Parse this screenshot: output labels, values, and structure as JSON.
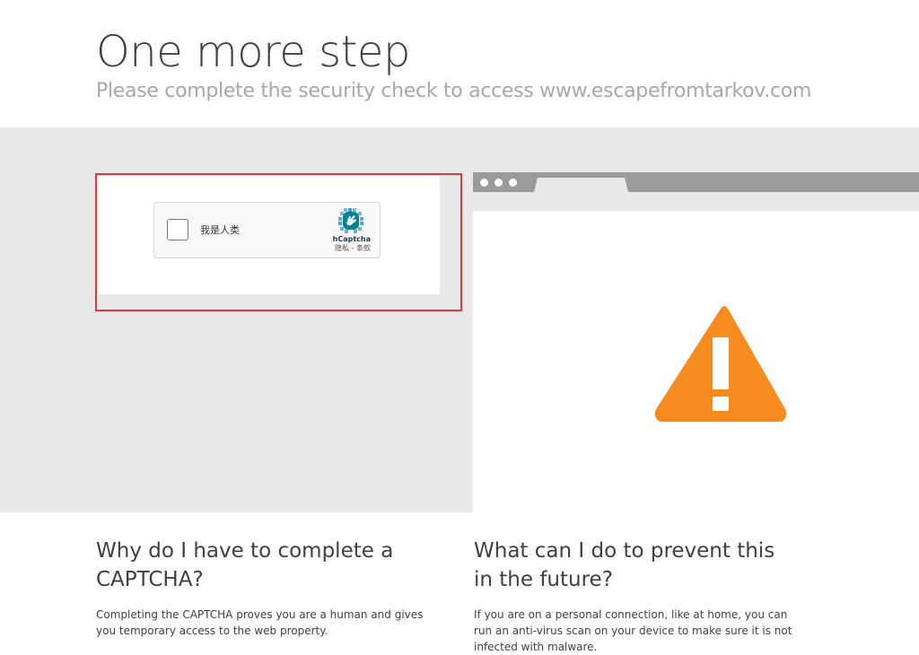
{
  "header": {
    "title": "One more step",
    "subtitle": "Please complete the security check to access www.escapefromtarkov.com"
  },
  "captcha": {
    "checkbox_label": "我是人类",
    "brand": "hCaptcha",
    "links": "隐私 - 条款",
    "highlight_color": "#e0383e"
  },
  "browser": {
    "warning_color": "#f68b1f",
    "warning_icon": "warning-triangle-exclamation"
  },
  "sections": [
    {
      "heading": "Why do I have to complete a CAPTCHA?",
      "text": "Completing the CAPTCHA proves you are a human and gives you temporary access to the web property."
    },
    {
      "heading": "What can I do to prevent this in the future?",
      "text": "If you are on a personal connection, like at home, you can run an anti-virus scan on your device to make sure it is not infected with malware."
    }
  ]
}
